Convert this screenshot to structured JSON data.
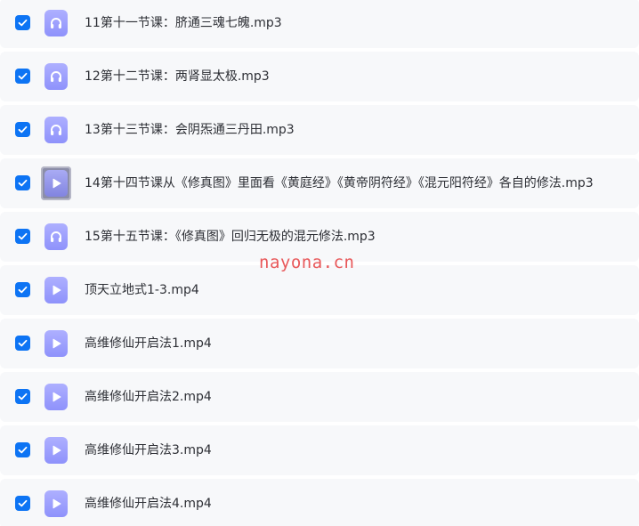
{
  "files": [
    {
      "name": "11第十一节课：脐通三魂七魄.mp3",
      "type": "audio",
      "checked": true
    },
    {
      "name": "12第十二节课：两肾显太极.mp3",
      "type": "audio",
      "checked": true
    },
    {
      "name": "13第十三节课：会阴炁通三丹田.mp3",
      "type": "audio",
      "checked": true
    },
    {
      "name": "14第十四节课从《修真图》里面看《黄庭经》《黄帝阴符经》《混元阳符经》各自的修法.mp3",
      "type": "audio-highlighted",
      "checked": true
    },
    {
      "name": "15第十五节课：《修真图》回归无极的混元修法.mp3",
      "type": "audio",
      "checked": true
    },
    {
      "name": "顶天立地式1-3.mp4",
      "type": "video",
      "checked": true
    },
    {
      "name": "高维修仙开启法1.mp4",
      "type": "video",
      "checked": true
    },
    {
      "name": "高维修仙开启法2.mp4",
      "type": "video",
      "checked": true
    },
    {
      "name": "高维修仙开启法3.mp4",
      "type": "video",
      "checked": true
    },
    {
      "name": "高维修仙开启法4.mp4",
      "type": "video",
      "checked": true
    }
  ],
  "watermark": "nayona.cn",
  "colors": {
    "checkbox": "#0d74f4",
    "icon": "#9c9efc",
    "row_bg": "#f7f8fa",
    "watermark": "#e8585a"
  },
  "icons": {
    "audio": "headphones-icon",
    "video": "play-icon",
    "check": "checkmark-icon"
  }
}
